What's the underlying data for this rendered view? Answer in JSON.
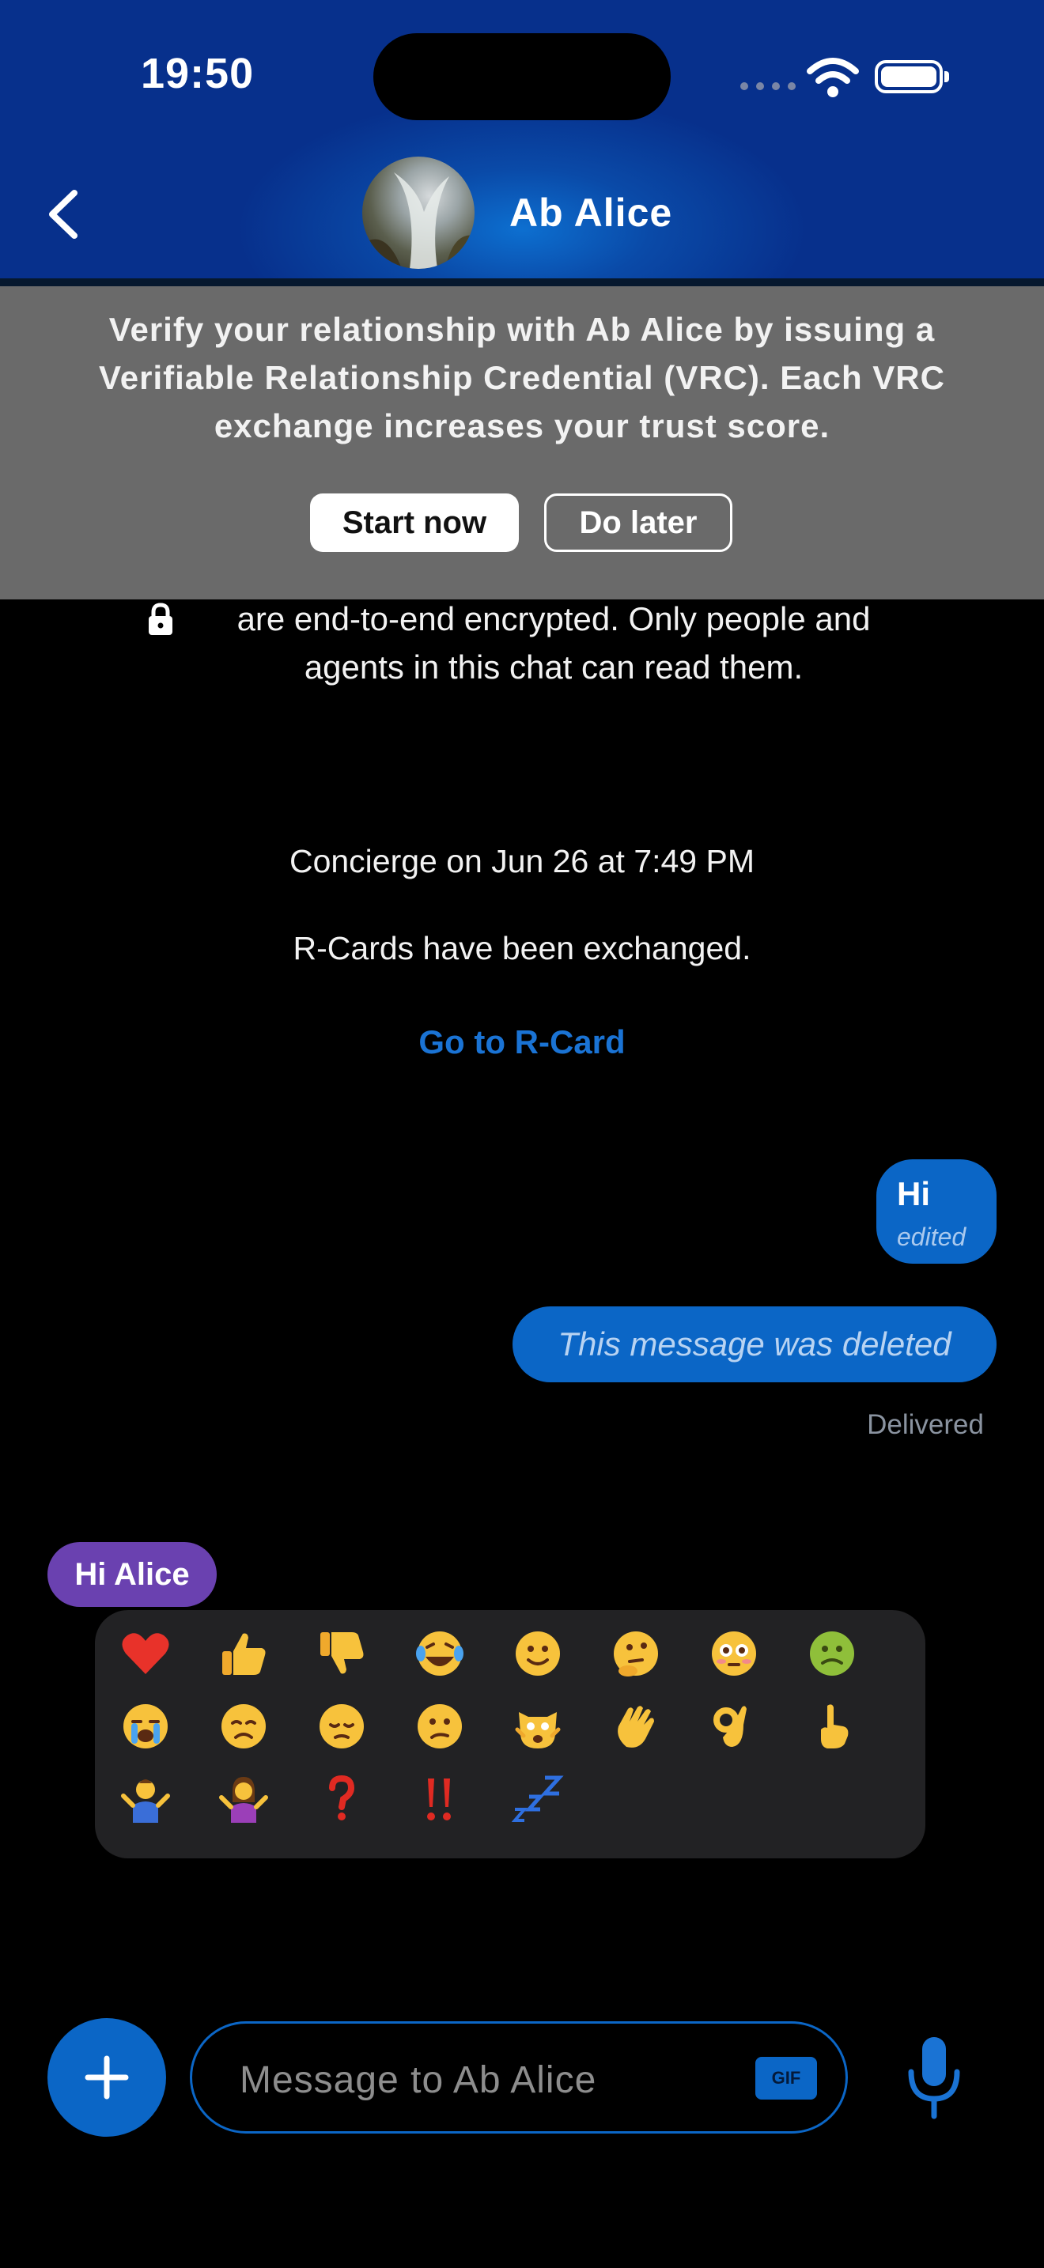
{
  "status_bar": {
    "time": "19:50"
  },
  "header": {
    "contact_name": "Ab Alice",
    "back_icon": "chevron-left-icon",
    "avatar_icon": "avatar-photo"
  },
  "vrc_banner": {
    "text": "Verify your relationship with Ab Alice by issuing a Verifiable Relationship Credential (VRC). Each VRC exchange increases your trust score.",
    "start_label": "Start now",
    "later_label": "Do later"
  },
  "encryption_notice": {
    "text": "are end-to-end encrypted. Only people and agents in this chat can read them.",
    "icon": "lock-icon"
  },
  "system_message": {
    "date": "Concierge on Jun 26 at 7:49 PM",
    "text": "R-Cards have been exchanged.",
    "link": "Go to R-Card"
  },
  "messages": [
    {
      "text": "Hi",
      "meta": "edited"
    },
    {
      "text": "This message was deleted"
    }
  ],
  "delivery_status": "Delivered",
  "reaction_target": "Hi Alice",
  "reactions": [
    "❤️",
    "👍",
    "👎",
    "😂",
    "🙂",
    "🤔",
    "😳",
    "🤢",
    "😭",
    "😞",
    "😔",
    "😕",
    "🙀",
    "👋",
    "👌",
    "☝️",
    "🤷‍♂️",
    "🤷‍♀️",
    "❓",
    "‼️",
    "💤"
  ],
  "composer": {
    "placeholder": "Message to Ab Alice",
    "gif_label": "GIF",
    "plus_icon": "plus-icon",
    "mic_icon": "microphone-icon"
  },
  "colors": {
    "accent": "#0b66c6",
    "header": "#07308c",
    "banner": "#6a6a6a",
    "reply_pill": "#6a41b0"
  }
}
